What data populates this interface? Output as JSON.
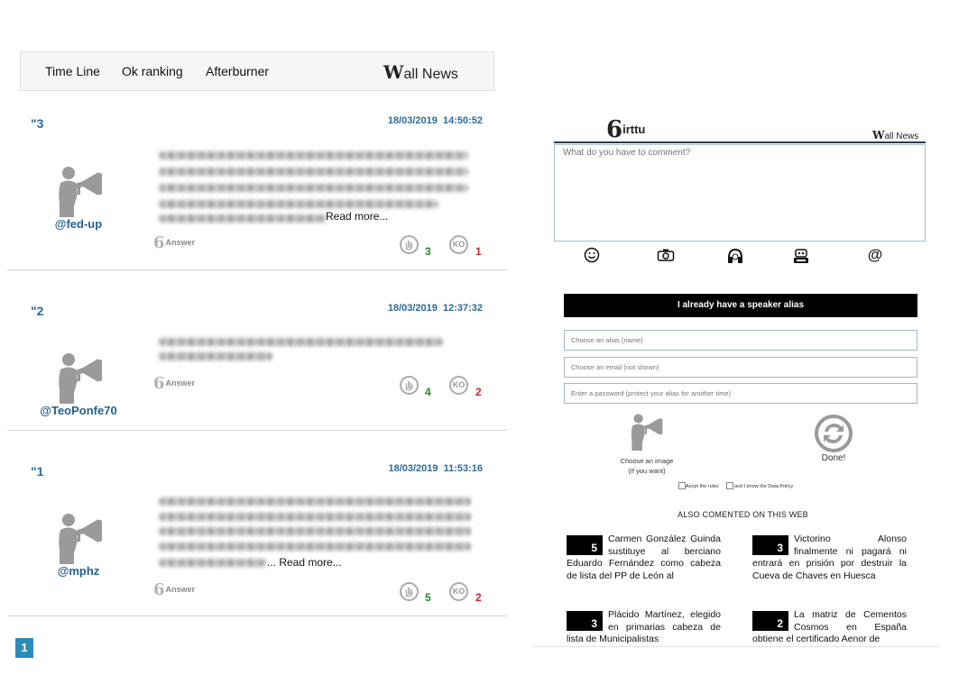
{
  "nav": {
    "items": [
      {
        "label": "Time Line"
      },
      {
        "label": "Ok ranking"
      },
      {
        "label": "Afterburner"
      }
    ],
    "logo_initial": "W",
    "logo_rest": "all News"
  },
  "posts": [
    {
      "num": "\"3",
      "date": "18/03/2019  14:50:52",
      "user": "@fed-up",
      "read_more": "Read more...",
      "answer": "Answer",
      "ok": "3",
      "ko": "1"
    },
    {
      "num": "\"2",
      "date": "18/03/2019  12:37:32",
      "user": "@TeoPonfe70",
      "read_more": "",
      "answer": "Answer",
      "ok": "4",
      "ko": "2"
    },
    {
      "num": "\"1",
      "date": "18/03/2019  11:53:16",
      "user": "@mphz",
      "read_more": "... Read more...",
      "answer": "Answer",
      "ok": "5",
      "ko": "2"
    }
  ],
  "vote": {
    "ko_icon_text": "KO"
  },
  "pagination": {
    "current": "1"
  },
  "panel": {
    "brand_initial": "V",
    "brand_rest": "irttu",
    "wall_initial": "W",
    "wall_rest": "all News",
    "comment_placeholder": "What do you have to comment?",
    "toolbar": [
      "smiley-icon",
      "camera-icon",
      "headphones-icon",
      "robot-icon",
      "at-icon"
    ],
    "alias_button": "I already have a speaker alias",
    "alias_placeholder": "Choose an alias (name)",
    "email_placeholder": "Choose an email (not shown)",
    "password_placeholder": "Enter a password (protect your alias for another time)",
    "choose_image": "Choose an image",
    "if_you_want": "(If you want)",
    "done": "Done!",
    "accept_rules": "Acept the rules",
    "data_policy": "and I know the Data Policy",
    "also_title": "ALSO COMENTED ON THIS WEB"
  },
  "news": [
    {
      "count": "5",
      "text": "Carmen González Guinda sustituye al berciano Eduardo Fernández como cabeza de lista del PP de León al"
    },
    {
      "count": "3",
      "text": "Victorino Alonso finalmente ni pagará ni entrará en prisión por destruir la Cueva de Chaves en Huesca"
    },
    {
      "count": "3",
      "text": "Plácido Martínez, elegido en primarias cabeza de lista de Municipalistas"
    },
    {
      "count": "2",
      "text": "La matriz de Cementos Cosmos en España obtiene el certificado Aenor de"
    }
  ]
}
